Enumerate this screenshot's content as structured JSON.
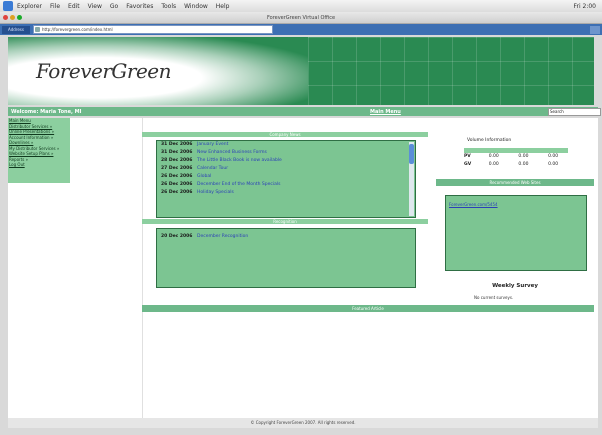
{
  "menubar": {
    "app": "Explorer",
    "items": [
      "File",
      "Edit",
      "View",
      "Go",
      "Favorites",
      "Tools",
      "Window",
      "Help"
    ],
    "right": [
      "Fri 2:00"
    ]
  },
  "window": {
    "title": "ForeverGreen Virtual Office"
  },
  "address": {
    "label": "Address",
    "url": "http://forevergreen.com/index.html"
  },
  "banner": {
    "logo": "ForeverGreen"
  },
  "navbar": {
    "welcome": "Welcome: Maria Tone, MI",
    "main_menu": "Main Menu",
    "search_value": "Search"
  },
  "sidebar": {
    "items": [
      {
        "label": "Main Menu",
        "link": true
      },
      {
        "label": "Distributor Services »",
        "link": true
      },
      {
        "label": "Online Presentations »",
        "link": true
      },
      {
        "label": "Account Information »",
        "link": false
      },
      {
        "label": "Downlines »",
        "link": true
      },
      {
        "label": "My Distributor Services »",
        "link": false
      },
      {
        "label": "Website Setup Plans »",
        "link": true
      },
      {
        "label": "Reports »",
        "link": false
      },
      {
        "label": "Log Out",
        "link": true
      }
    ]
  },
  "news": {
    "header": "Company News",
    "items": [
      {
        "date": "31 Dec 2006",
        "title": "January Event"
      },
      {
        "date": "31 Dec 2006",
        "title": "New Enhanced Business Forms"
      },
      {
        "date": "28 Dec 2006",
        "title": "The Little Black Book is now available"
      },
      {
        "date": "27 Dec 2006",
        "title": "Calendar Tour"
      },
      {
        "date": "26 Dec 2006",
        "title": "Global"
      },
      {
        "date": "26 Dec 2006",
        "title": "December End of the Month Specials"
      },
      {
        "date": "26 Dec 2006",
        "title": "Holiday Specials"
      }
    ]
  },
  "events": {
    "header": "Recognition",
    "items": [
      {
        "date": "20 Dec 2006",
        "title": "December Recognition"
      }
    ]
  },
  "volume": {
    "title": "Volume Information",
    "rows": [
      {
        "label": "PV",
        "values": [
          "0.00",
          "0.00",
          "0.00"
        ]
      },
      {
        "label": "GV",
        "values": [
          "0.00",
          "0.00",
          "0.00"
        ]
      }
    ]
  },
  "unused": {
    "header": "Recommended Web Sites",
    "link": "ForeverGreen.com/5454"
  },
  "survey": {
    "title": "Weekly Survey",
    "text": "No current surveys."
  },
  "featured": {
    "header": "Featured Article"
  },
  "footer": {
    "text": "© Copyright ForeverGreen 2007. All rights reserved."
  },
  "colors": {
    "primary": "#6db88a",
    "banner": "#2a8a52",
    "link": "#2b3fb8",
    "panel": "#7cc592"
  }
}
